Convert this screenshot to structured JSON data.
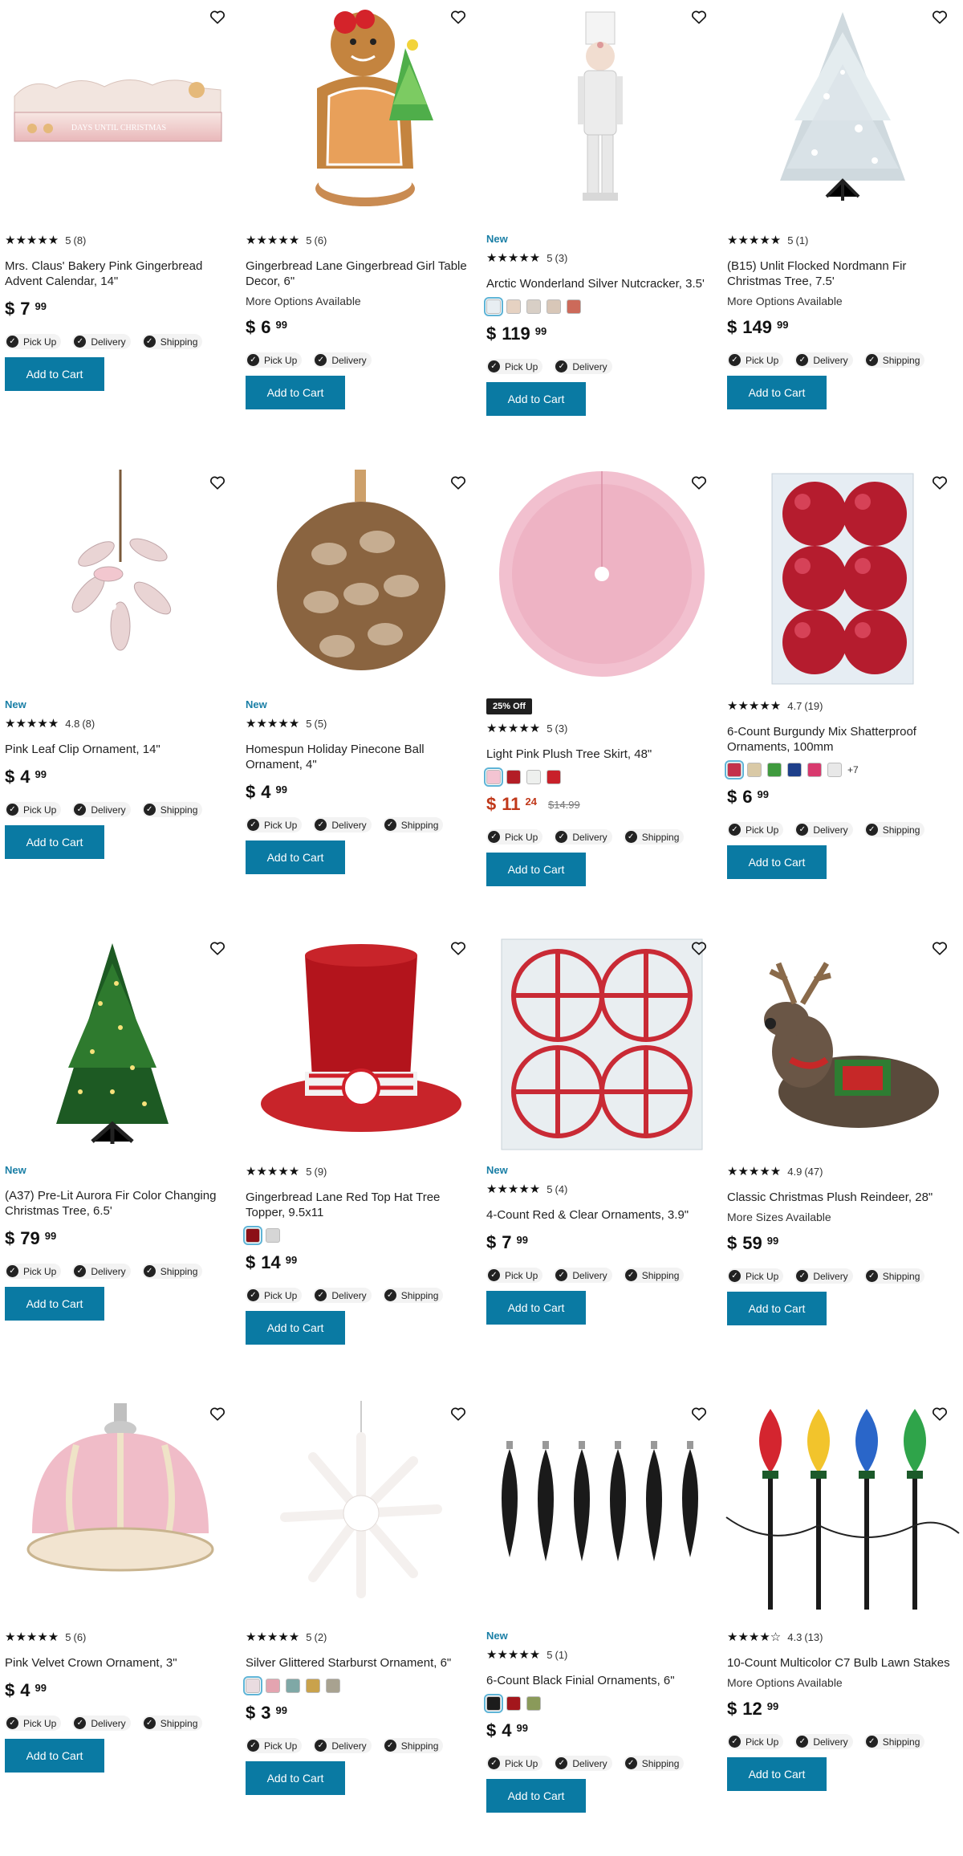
{
  "colors": {
    "accent": "#0a7aa3",
    "sale": "#c0381a",
    "new": "#1a7fa6"
  },
  "fulfillment_labels": {
    "pickup": "Pick Up",
    "delivery": "Delivery",
    "shipping": "Shipping"
  },
  "cart_label": "Add to Cart",
  "products": [
    {
      "name": "Mrs. Claus' Bakery Pink Gingerbread Advent Calendar, 14\"",
      "rating": "5",
      "reviews": "(8)",
      "stars": "★★★★★",
      "dollars": "7",
      "cents": "99",
      "new": "",
      "sale_tag": "",
      "was": "",
      "options": "",
      "image": "advent-calendar",
      "fulfill": [
        "pickup",
        "delivery",
        "shipping"
      ]
    },
    {
      "name": "Gingerbread Lane Gingerbread Girl Table Decor, 6\"",
      "rating": "5",
      "reviews": "(6)",
      "stars": "★★★★★",
      "dollars": "6",
      "cents": "99",
      "new": "",
      "sale_tag": "",
      "was": "",
      "options": "More Options Available",
      "image": "gingerbread-girl",
      "fulfill": [
        "pickup",
        "delivery"
      ]
    },
    {
      "name": "Arctic Wonderland Silver Nutcracker, 3.5'",
      "rating": "5",
      "reviews": "(3)",
      "stars": "★★★★★",
      "dollars": "119",
      "cents": "99",
      "new": "New",
      "sale_tag": "",
      "was": "",
      "options": "",
      "image": "nutcracker",
      "fulfill": [
        "pickup",
        "delivery"
      ]
    },
    {
      "name": "(B15) Unlit Flocked Nordmann Fir Christmas Tree, 7.5'",
      "rating": "5",
      "reviews": "(1)",
      "stars": "★★★★★",
      "dollars": "149",
      "cents": "99",
      "new": "",
      "sale_tag": "",
      "was": "",
      "options": "More Options Available",
      "image": "flocked-tree",
      "fulfill": [
        "pickup",
        "delivery",
        "shipping"
      ]
    },
    {
      "name": "Pink Leaf Clip Ornament, 14\"",
      "rating": "4.8",
      "reviews": "(8)",
      "stars": "★★★★★",
      "dollars": "4",
      "cents": "99",
      "new": "New",
      "sale_tag": "",
      "was": "",
      "options": "",
      "image": "leaf-clip",
      "fulfill": [
        "pickup",
        "delivery",
        "shipping"
      ]
    },
    {
      "name": "Homespun Holiday Pinecone Ball Ornament, 4\"",
      "rating": "5",
      "reviews": "(5)",
      "stars": "★★★★★",
      "dollars": "4",
      "cents": "99",
      "new": "New",
      "sale_tag": "",
      "was": "",
      "options": "",
      "image": "pinecone",
      "fulfill": [
        "pickup",
        "delivery",
        "shipping"
      ]
    },
    {
      "name": "Light Pink Plush Tree Skirt, 48\"",
      "rating": "5",
      "reviews": "(3)",
      "stars": "★★★★★",
      "dollars": "11",
      "cents": "24",
      "new": "",
      "sale_tag": "25% Off",
      "was": "$14.99",
      "options": "",
      "image": "tree-skirt",
      "fulfill": [
        "pickup",
        "delivery",
        "shipping"
      ]
    },
    {
      "name": "6-Count Burgundy Mix Shatterproof Ornaments, 100mm",
      "rating": "4.7",
      "reviews": "(19)",
      "stars": "★★★★★",
      "dollars": "6",
      "cents": "99",
      "new": "",
      "sale_tag": "",
      "was": "",
      "options": "",
      "image": "burgundy-ornaments",
      "fulfill": [
        "pickup",
        "delivery",
        "shipping"
      ]
    },
    {
      "name": "(A37) Pre-Lit Aurora Fir Color Changing Christmas Tree, 6.5'",
      "rating": "",
      "reviews": "",
      "stars": "",
      "dollars": "79",
      "cents": "99",
      "new": "New",
      "sale_tag": "",
      "was": "",
      "options": "",
      "image": "prelit-tree",
      "fulfill": [
        "pickup",
        "delivery",
        "shipping"
      ]
    },
    {
      "name": "Gingerbread Lane Red Top Hat Tree Topper, 9.5x11",
      "rating": "5",
      "reviews": "(9)",
      "stars": "★★★★★",
      "dollars": "14",
      "cents": "99",
      "new": "",
      "sale_tag": "",
      "was": "",
      "options": "",
      "image": "top-hat",
      "fulfill": [
        "pickup",
        "delivery",
        "shipping"
      ]
    },
    {
      "name": "4-Count Red & Clear Ornaments, 3.9\"",
      "rating": "5",
      "reviews": "(4)",
      "stars": "★★★★★",
      "dollars": "7",
      "cents": "99",
      "new": "New",
      "sale_tag": "",
      "was": "",
      "options": "",
      "image": "red-clear-ornaments",
      "fulfill": [
        "pickup",
        "delivery",
        "shipping"
      ]
    },
    {
      "name": "Classic Christmas Plush Reindeer, 28\"",
      "rating": "4.9",
      "reviews": "(47)",
      "stars": "★★★★★",
      "dollars": "59",
      "cents": "99",
      "new": "",
      "sale_tag": "",
      "was": "",
      "options": "More Sizes Available",
      "image": "reindeer",
      "fulfill": [
        "pickup",
        "delivery",
        "shipping"
      ]
    },
    {
      "name": "Pink Velvet Crown Ornament, 3\"",
      "rating": "5",
      "reviews": "(6)",
      "stars": "★★★★★",
      "dollars": "4",
      "cents": "99",
      "new": "",
      "sale_tag": "",
      "was": "",
      "options": "",
      "image": "crown",
      "fulfill": [
        "pickup",
        "delivery",
        "shipping"
      ]
    },
    {
      "name": "Silver Glittered Starburst Ornament, 6\"",
      "rating": "5",
      "reviews": "(2)",
      "stars": "★★★★★",
      "dollars": "3",
      "cents": "99",
      "new": "",
      "sale_tag": "",
      "was": "",
      "options": "",
      "image": "starburst",
      "fulfill": [
        "pickup",
        "delivery",
        "shipping"
      ]
    },
    {
      "name": "6-Count Black Finial Ornaments, 6\"",
      "rating": "5",
      "reviews": "(1)",
      "stars": "★★★★★",
      "dollars": "4",
      "cents": "99",
      "new": "New",
      "sale_tag": "",
      "was": "",
      "options": "",
      "image": "black-finials",
      "fulfill": [
        "pickup",
        "delivery",
        "shipping"
      ]
    },
    {
      "name": "10-Count Multicolor C7 Bulb Lawn Stakes",
      "rating": "4.3",
      "reviews": "(13)",
      "stars": "★★★★☆",
      "dollars": "12",
      "cents": "99",
      "new": "",
      "sale_tag": "",
      "was": "",
      "options": "More Options Available",
      "image": "bulb-stakes",
      "fulfill": [
        "pickup",
        "delivery",
        "shipping"
      ]
    }
  ],
  "swatches": {
    "2": [
      "#e8eef2",
      "#e6d2c2",
      "#d8cfc6",
      "#d8c7b8",
      "#cc6a5a"
    ],
    "6": [
      "#f3c4d2",
      "#b31e26",
      "#eef0ee",
      "#c8202a"
    ],
    "7": [
      "#c4314a",
      "#d9c9a6",
      "#3f9a3e",
      "#1e3f8a",
      "#d83a6e",
      "#e8e8e8"
    ],
    "9": [
      "#8c1016",
      "#d6d6d6"
    ],
    "13": [
      "#e9dce0",
      "#e4a4b0",
      "#7fa8a6",
      "#c9a24c",
      "#a8a290"
    ],
    "14": [
      "#1c1c1c",
      "#a3161c",
      "#8a9a5a"
    ]
  },
  "swatch_more": {
    "7": "+7"
  }
}
